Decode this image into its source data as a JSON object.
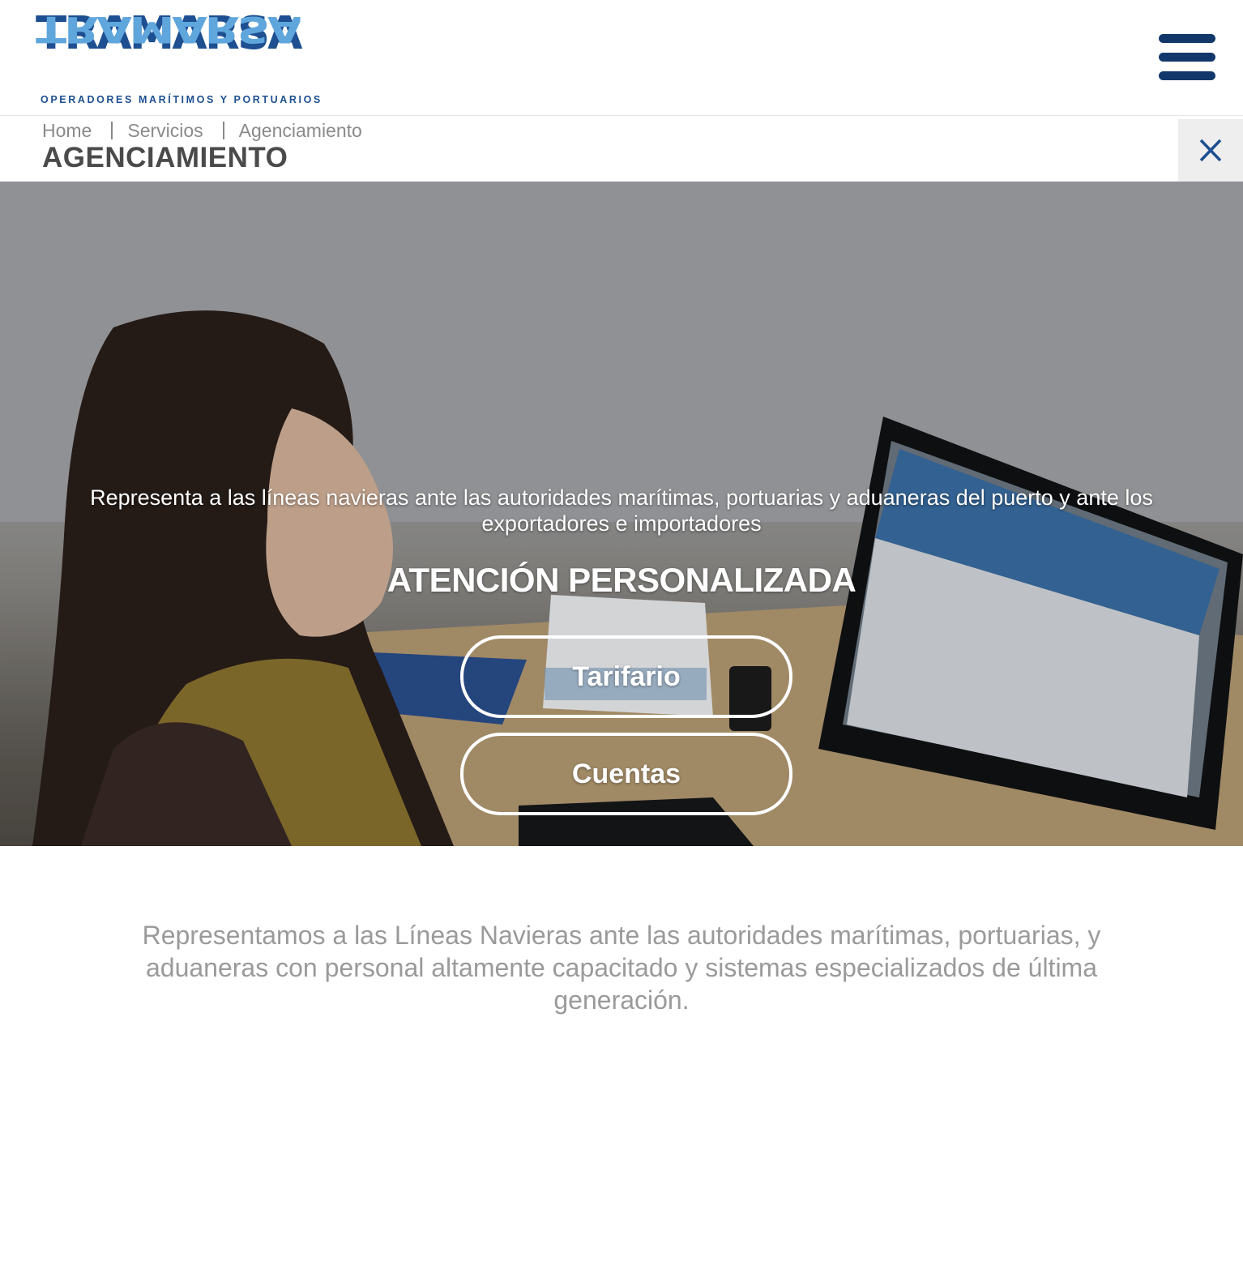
{
  "header": {
    "logo_word": "TRAMARSA",
    "logo_tagline": "OPERADORES MARÍTIMOS Y PORTUARIOS",
    "menu_icon": "hamburger-menu-icon"
  },
  "breadcrumb": {
    "items": [
      "Home",
      "Servicios",
      "Agenciamiento"
    ]
  },
  "page_title": "AGENCIAMIENTO",
  "close_icon": "close-icon",
  "hero": {
    "description": "Representa a las líneas navieras ante las autoridades marítimas, portuarias y aduaneras del puerto y ante los exportadores e importadores",
    "heading": "ATENCIÓN PERSONALIZADA",
    "buttons": [
      "Tarifario",
      "Cuentas"
    ]
  },
  "intro_text": "Representamos a las Líneas Navieras ante las autoridades marítimas, portuarias, y aduaneras con personal altamente capacitado y sistemas especializados de última generación.",
  "colors": {
    "brand_dark": "#12386b",
    "brand_blue": "#1d4f91",
    "brand_light": "#5fa6dd",
    "text_gray": "#9a9a9a"
  }
}
